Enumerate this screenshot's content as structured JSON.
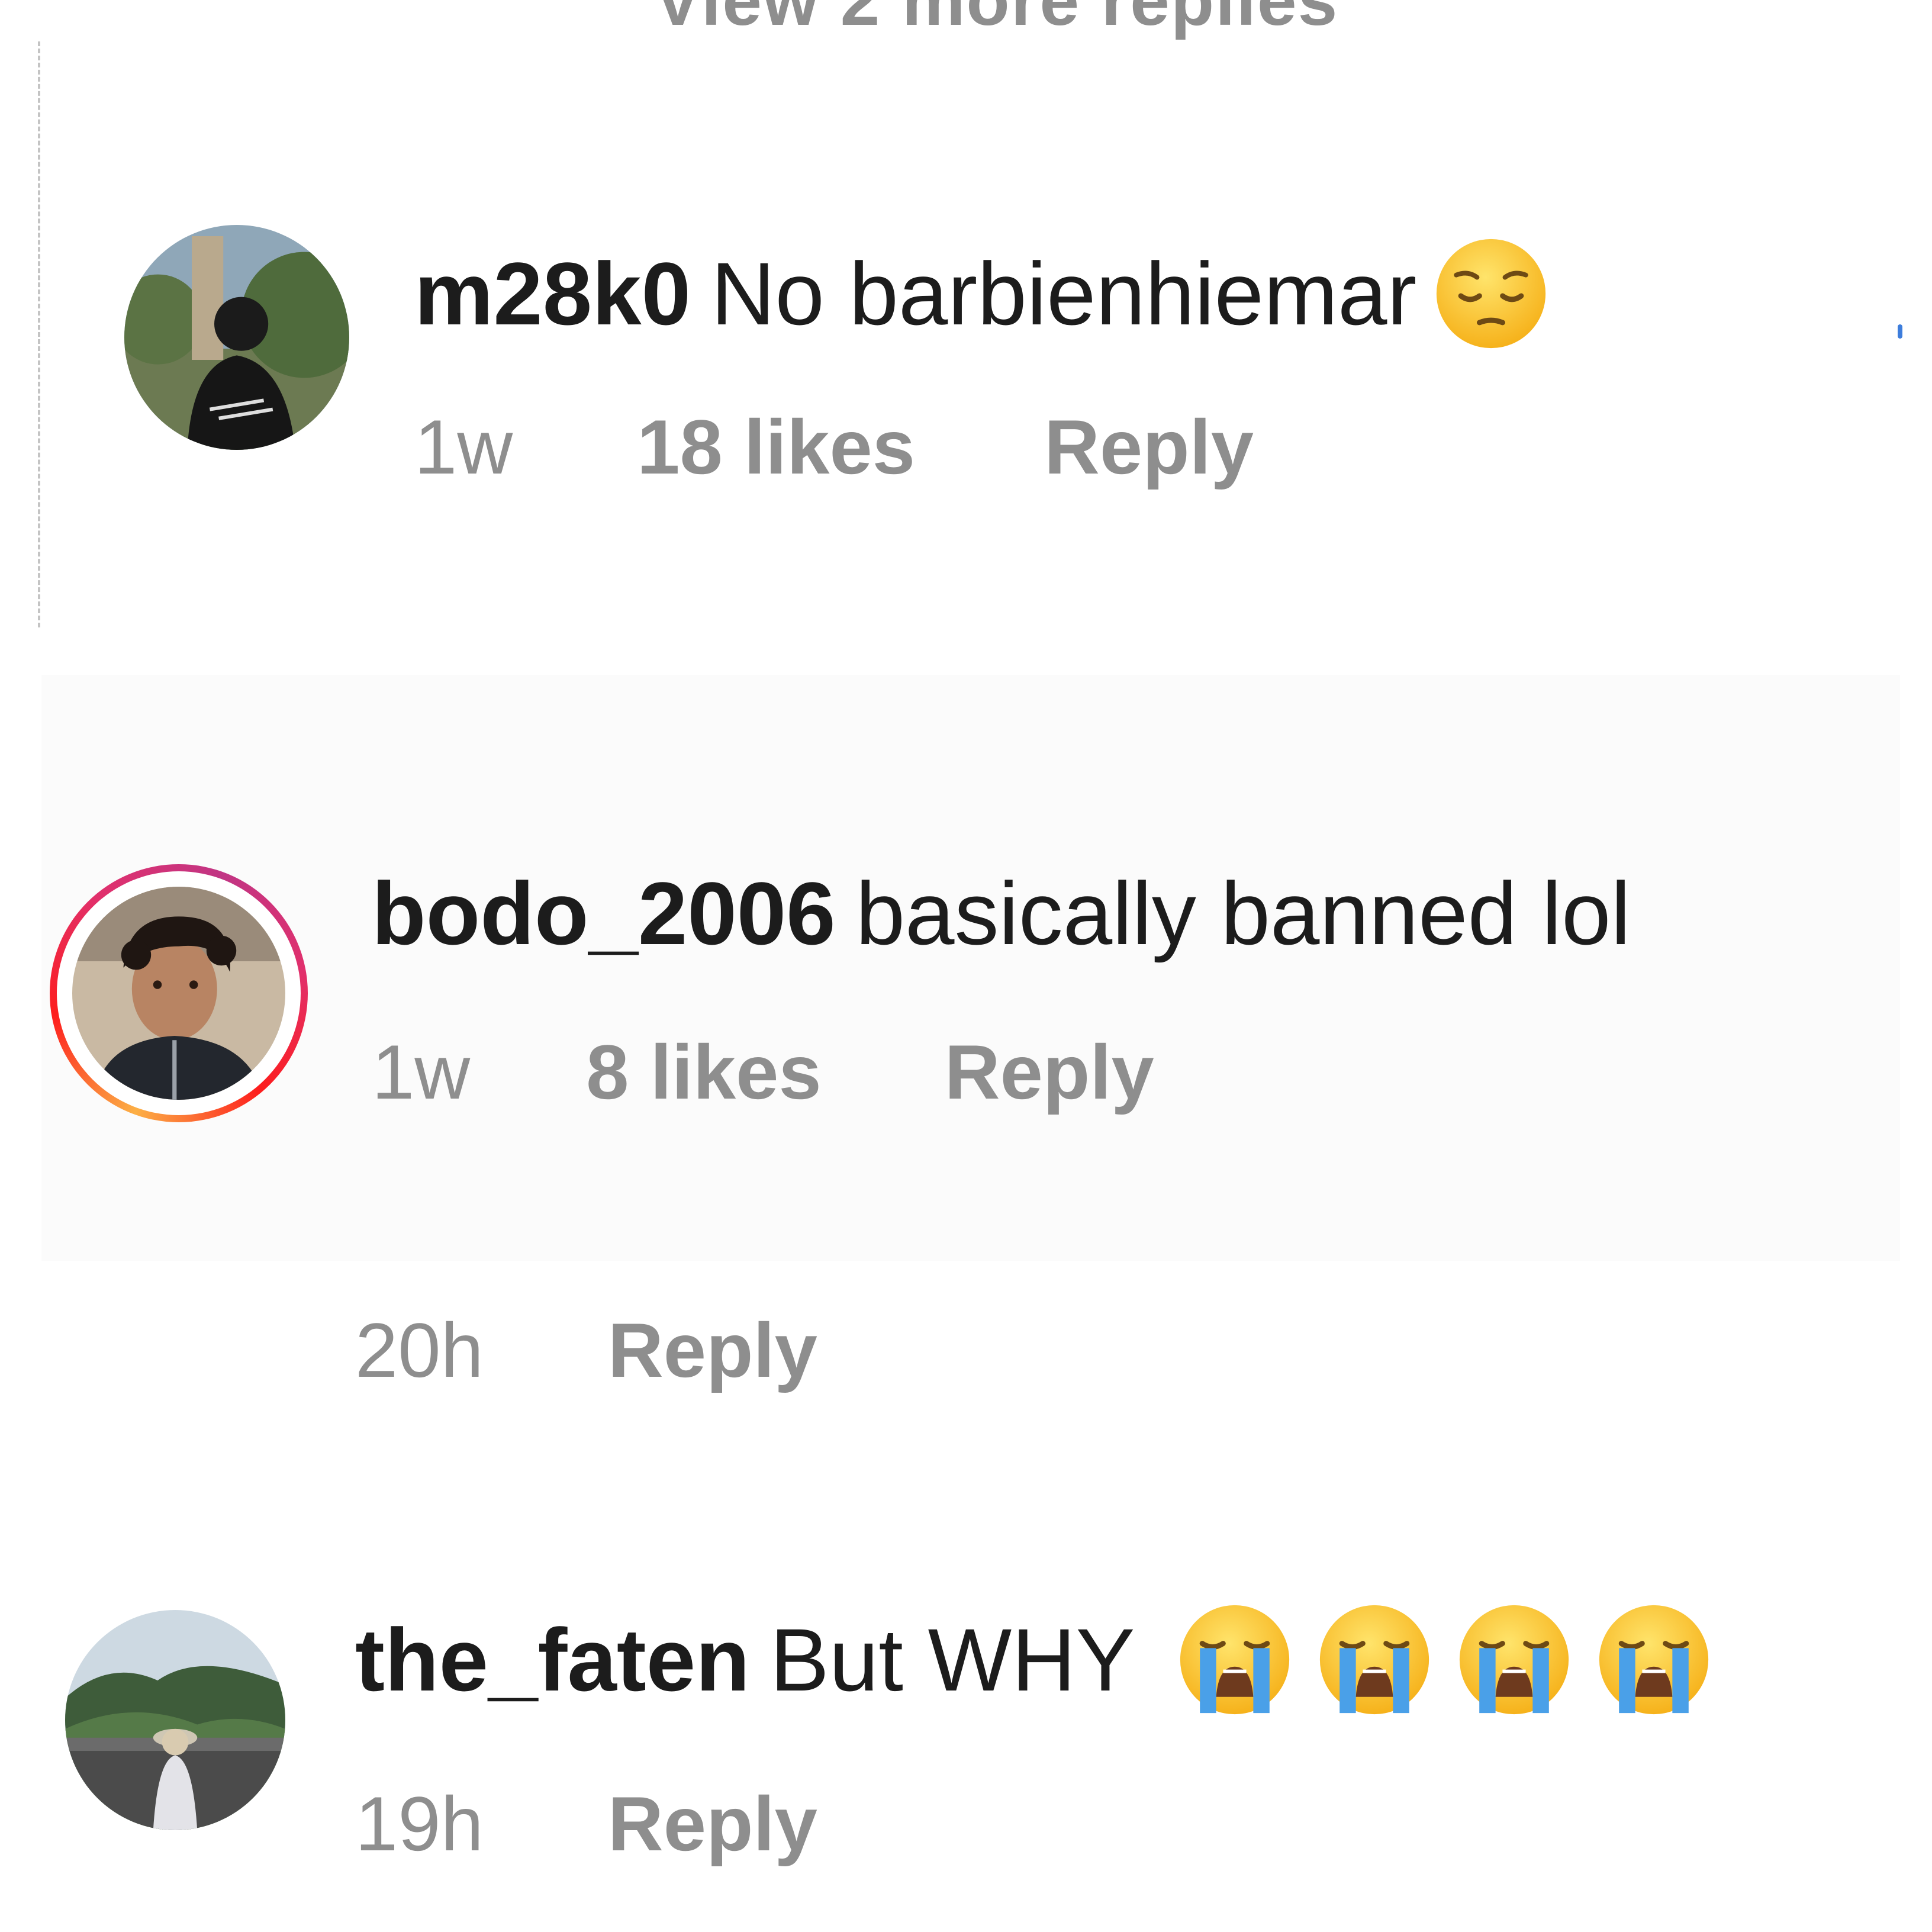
{
  "top_cut_text": "View 2 more replies",
  "comments": [
    {
      "username": "m28k0",
      "text": "No barbienhiemar",
      "emoji_names": [
        "pensive-face-icon"
      ],
      "time": "1w",
      "likes": "18 likes",
      "reply": "Reply"
    },
    {
      "username": "bodo_2006",
      "text": "basically banned lol",
      "time": "1w",
      "likes": "8 likes",
      "reply": "Reply",
      "has_story_ring": true
    },
    {
      "time": "20h",
      "reply": "Reply"
    },
    {
      "username": "the_faten",
      "text": "But WHY",
      "emoji_names": [
        "crying-face-icon",
        "crying-face-icon",
        "crying-face-icon",
        "crying-face-icon"
      ],
      "time": "19h",
      "reply": "Reply"
    }
  ],
  "colors": {
    "text": "#1c1c1c",
    "meta": "#8e8e8e",
    "story_ring_start": "#fcaf45",
    "story_ring_end": "#c13584",
    "highlight_bg": "#fbfbfb"
  }
}
